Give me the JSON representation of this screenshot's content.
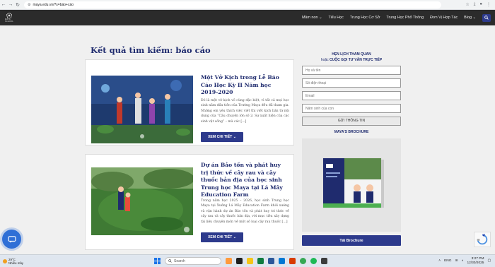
{
  "browser": {
    "url": "maya.edu.vn/?s=báo+cáo"
  },
  "site": {
    "logo_text": "MAYA SCHOOL",
    "menu": [
      {
        "label": "Mầm non",
        "has_dropdown": true
      },
      {
        "label": "Tiểu Học",
        "has_dropdown": false
      },
      {
        "label": "Trung Học Cơ Sở",
        "has_dropdown": false
      },
      {
        "label": "Trung Học Phổ Thông",
        "has_dropdown": false
      },
      {
        "label": "Đơn Vị Hợp Tác",
        "has_dropdown": false
      },
      {
        "label": "Blog",
        "has_dropdown": true
      }
    ],
    "search_icon": "search-icon"
  },
  "main": {
    "page_title": "Kết quả tìm kiếm: báo cáo",
    "posts": [
      {
        "title": "Một Vở Kịch trong Lễ Báo Cáo Học Kỳ II Năm học 2019-2020",
        "excerpt": "Đó là một vở kịch vô cùng đặc biệt, vì tất cả mọi học sinh năm đầu tiên của Trường Maya đều đã tham gia. Những em yêu thích việc viết thì viết kịch bản từ nội dung của “Câu chuyện lớn số 2: Sự xuất hiện của các sinh vật sống” – mà các [...]",
        "more_label": "XEM CHI TIẾT",
        "image_alt": "photo-school-play"
      },
      {
        "title": "Dự án Bảo tồn và phát huy trị thức về cây rau và cây thuốc bản địa của học sinh Trung học Maya tại Lá Mây Education Farm",
        "excerpt": "Trong năm học 2025 – 2026, học sinh Trung học Maya tại Xưởng Lá Mây Education Farm khởi xướng và vận hành dự án Bảo tồn và phát huy tri thức về cây rau và cây thuốc bản địa, với mục tiêu xây dựng tài liệu chuyên môn về một số loại cây rau thuốc [...]",
        "more_label": "XEM CHI TIẾT",
        "image_alt": "photo-students-farm"
      }
    ]
  },
  "sidebar": {
    "heading_1": "HẸN LỊCH THAM QUAN",
    "heading_2_prefix": "hoặc",
    "heading_2": "CUỘC GỌI TƯ VẤN TRỰC TIẾP",
    "fields": [
      {
        "placeholder": "Họ và tên"
      },
      {
        "placeholder": "Số điện thoại"
      },
      {
        "placeholder": "Email"
      },
      {
        "placeholder": "Năm sinh của con"
      }
    ],
    "submit_label": "GỬI THÔNG TIN",
    "brochure_heading": "MAYA'S BROCHURE",
    "brochure_button": "Tải Brochure"
  },
  "taskbar": {
    "weather_temp": "29°C",
    "weather_desc": "Nhiều mây",
    "search_placeholder": "Search",
    "lang": "ENG",
    "time": "3:27 PM",
    "date": "12/30/2025"
  },
  "colors": {
    "brand_navy": "#1f2b6e",
    "button_blue": "#2d3a8c",
    "header_dark": "#2b2b2b"
  }
}
